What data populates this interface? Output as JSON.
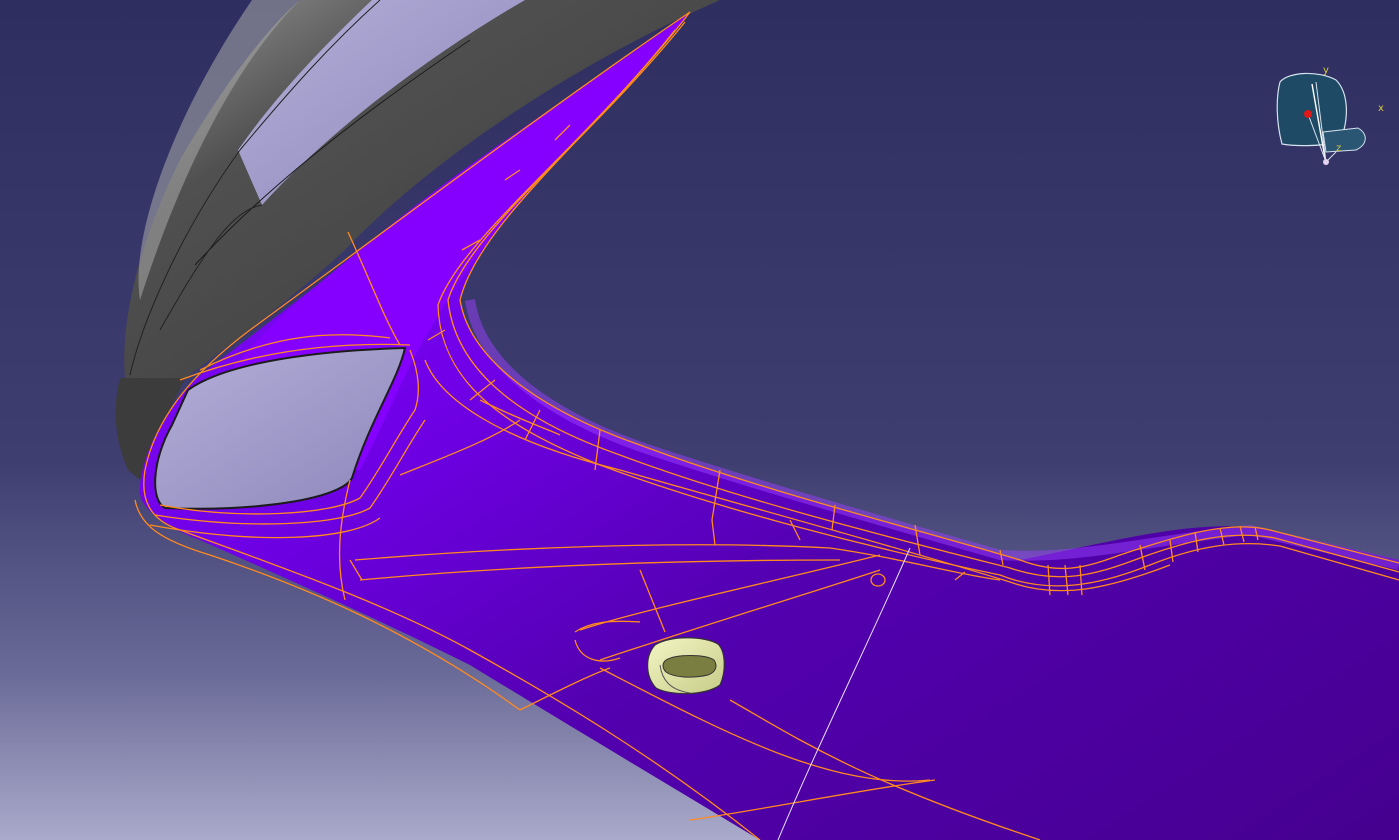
{
  "compass": {
    "x_label": "x",
    "y_label": "y",
    "z_label": "z",
    "colors": {
      "axis_text": "#d8c840",
      "plane": "#1f4a66",
      "edge": "#d6e2ee",
      "origin": "#e01818"
    }
  },
  "colors": {
    "background_top": "#2f2f62",
    "background_bottom": "#a8a8c8",
    "surface_light": "#8400ff",
    "surface_dark": "#4a0098",
    "edge_lines": "#ff8a1e",
    "shell_dark": "#4c4c4c",
    "glass": "#a6a0cc",
    "clip_part": "#e8ecaa"
  }
}
